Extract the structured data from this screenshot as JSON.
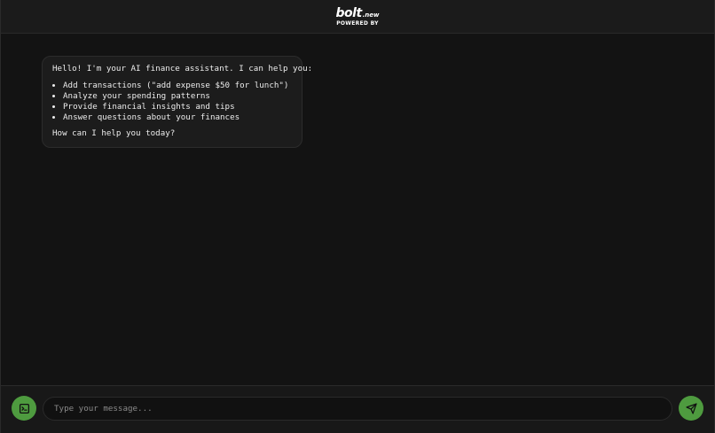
{
  "header": {
    "brand_name": "bolt",
    "brand_suffix": ".new",
    "caption": "POWERED BY"
  },
  "chat": {
    "messages": [
      {
        "role": "assistant",
        "intro": "Hello! I'm your AI finance assistant. I can help you:",
        "items": [
          "Add transactions (\"add expense $50 for lunch\")",
          "Analyze your spending patterns",
          "Provide financial insights and tips",
          "Answer questions about your finances"
        ],
        "closing": "How can I help you today?"
      }
    ]
  },
  "composer": {
    "placeholder": "Type your message...",
    "value": "",
    "left_icon": "terminal-icon",
    "send_icon": "send-icon"
  },
  "colors": {
    "accent": "#4e9b3f",
    "background": "#131313",
    "header_bg": "#1b1b1b",
    "bubble_bg": "#1c1c1c"
  }
}
